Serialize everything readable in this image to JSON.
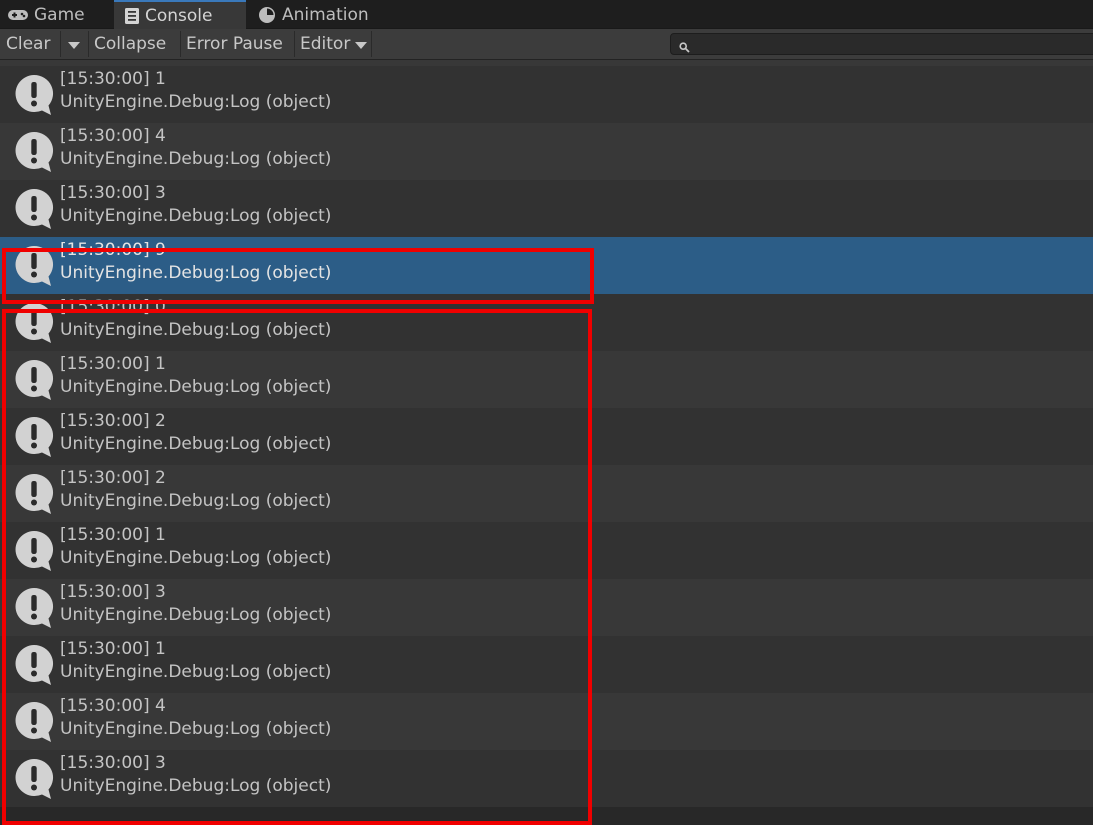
{
  "tabs": [
    {
      "label": "Game",
      "icon": "gamepad-icon",
      "active": false
    },
    {
      "label": "Console",
      "icon": "console-list-icon",
      "active": true
    },
    {
      "label": "Animation",
      "icon": "animation-clock-icon",
      "active": false
    }
  ],
  "toolbar": {
    "clear_label": "Clear",
    "collapse_label": "Collapse",
    "error_pause_label": "Error Pause",
    "editor_label": "Editor"
  },
  "search": {
    "placeholder": ""
  },
  "logs": [
    {
      "time": "",
      "message": "",
      "source": "UnityEngine.Debug:Log (object)",
      "selected": false,
      "partial": true
    },
    {
      "time": "[15:30:00]",
      "message": "1",
      "source": "UnityEngine.Debug:Log (object)",
      "selected": false
    },
    {
      "time": "[15:30:00]",
      "message": "4",
      "source": "UnityEngine.Debug:Log (object)",
      "selected": false
    },
    {
      "time": "[15:30:00]",
      "message": "3",
      "source": "UnityEngine.Debug:Log (object)",
      "selected": false
    },
    {
      "time": "[15:30:00]",
      "message": "9",
      "source": "UnityEngine.Debug:Log (object)",
      "selected": true
    },
    {
      "time": "[15:30:00]",
      "message": "0",
      "source": "UnityEngine.Debug:Log (object)",
      "selected": false
    },
    {
      "time": "[15:30:00]",
      "message": "1",
      "source": "UnityEngine.Debug:Log (object)",
      "selected": false
    },
    {
      "time": "[15:30:00]",
      "message": "2",
      "source": "UnityEngine.Debug:Log (object)",
      "selected": false
    },
    {
      "time": "[15:30:00]",
      "message": "2",
      "source": "UnityEngine.Debug:Log (object)",
      "selected": false
    },
    {
      "time": "[15:30:00]",
      "message": "1",
      "source": "UnityEngine.Debug:Log (object)",
      "selected": false
    },
    {
      "time": "[15:30:00]",
      "message": "3",
      "source": "UnityEngine.Debug:Log (object)",
      "selected": false
    },
    {
      "time": "[15:30:00]",
      "message": "1",
      "source": "UnityEngine.Debug:Log (object)",
      "selected": false
    },
    {
      "time": "[15:30:00]",
      "message": "4",
      "source": "UnityEngine.Debug:Log (object)",
      "selected": false
    },
    {
      "time": "[15:30:00]",
      "message": "3",
      "source": "UnityEngine.Debug:Log (object)",
      "selected": false
    }
  ],
  "colors": {
    "selected_row": "#2c5d87",
    "highlight_box": "#f00000",
    "active_tab_accent": "#3a79bb"
  }
}
